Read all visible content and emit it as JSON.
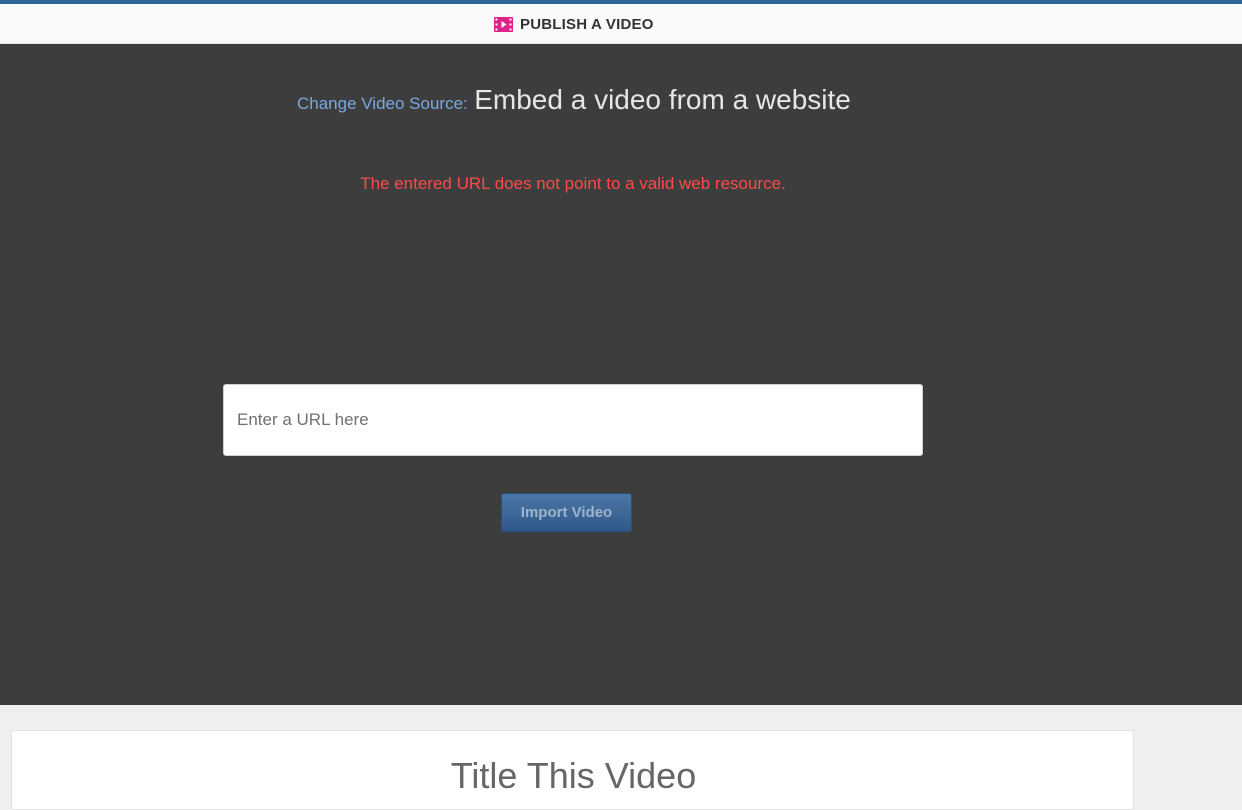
{
  "header": {
    "title": "PUBLISH A VIDEO",
    "icon": "film-icon",
    "icon_color": "#e0218a",
    "accent_color": "#2e6496"
  },
  "source": {
    "label": "Change Video Source:",
    "value": "Embed a video from a website"
  },
  "error": {
    "message": "The entered URL does not point to a valid web resource.",
    "color": "#ff4a4a"
  },
  "url_field": {
    "placeholder": "Enter a URL here",
    "value": ""
  },
  "import_button": {
    "label": "Import Video"
  },
  "title_section": {
    "heading": "Title This Video"
  }
}
